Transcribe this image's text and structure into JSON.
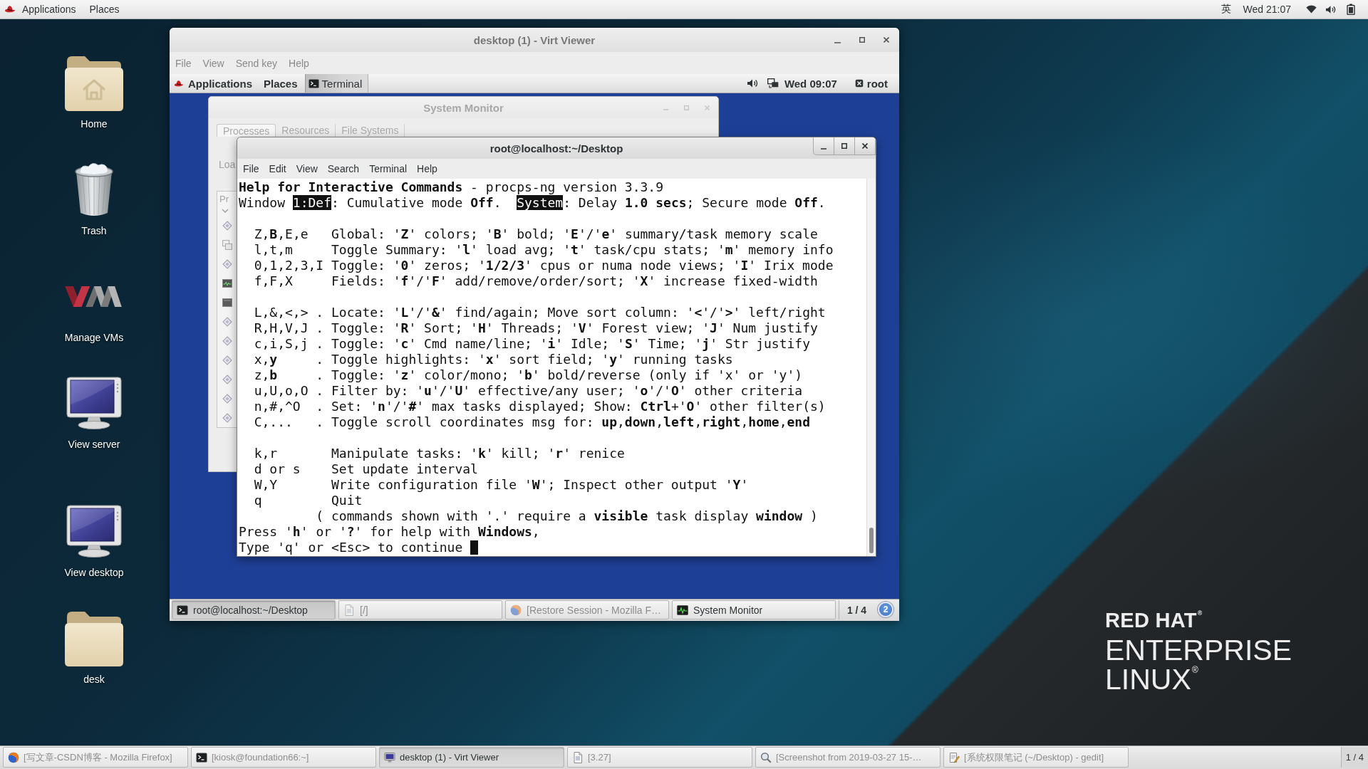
{
  "top_bar": {
    "applications": "Applications",
    "places": "Places",
    "input_method": "英",
    "clock": "Wed 21:07"
  },
  "desktop_icons": [
    {
      "kind": "home-folder",
      "label": "Home"
    },
    {
      "kind": "trash",
      "label": "Trash"
    },
    {
      "kind": "logo",
      "label": "Manage VMs"
    },
    {
      "kind": "monitor",
      "label": "View server"
    },
    {
      "kind": "monitor",
      "label": "View desktop"
    },
    {
      "kind": "folder",
      "label": "desk"
    }
  ],
  "viewer": {
    "title": "desktop (1) - Virt Viewer",
    "menu": [
      "File",
      "View",
      "Send key",
      "Help"
    ],
    "guest_top_bar": {
      "applications": "Applications",
      "places": "Places",
      "window_button": "Terminal",
      "clock": "Wed 09:07",
      "user": "root"
    },
    "system_monitor": {
      "title": "System Monitor",
      "tabs": [
        {
          "label": "Processes",
          "selected": true
        },
        {
          "label": "Resources",
          "selected": false
        },
        {
          "label": "File Systems",
          "selected": false
        }
      ],
      "load_label": "Loa",
      "column_header": "Pr"
    },
    "terminal": {
      "title": "root@localhost:~/Desktop",
      "menu": [
        "File",
        "Edit",
        "View",
        "Search",
        "Terminal",
        "Help"
      ],
      "lines": [
        {
          "kind": "heading",
          "text": "**Help for Interactive Commands** - procps-ng version 3.3.9"
        },
        {
          "kind": "status",
          "segments": [
            {
              "kind": "plain",
              "text": "Window "
            },
            {
              "kind": "reverse",
              "text": "1:Def"
            },
            {
              "kind": "plain",
              "text": ": Cumulative mode "
            },
            {
              "kind": "bold",
              "text": "Off"
            },
            {
              "kind": "plain",
              "text": ".  "
            },
            {
              "kind": "reverse",
              "text": "System"
            },
            {
              "kind": "plain",
              "text": ": Delay "
            },
            {
              "kind": "bold",
              "text": "1.0 secs"
            },
            {
              "kind": "plain",
              "text": "; Secure mode "
            },
            {
              "kind": "bold",
              "text": "Off"
            },
            {
              "kind": "plain",
              "text": "."
            }
          ]
        },
        {
          "kind": "blank"
        },
        {
          "kind": "command",
          "keys": "Z,**B**,E,e",
          "text": "Global: '**Z**' colors; '**B**' bold; '**E**'/'**e**' summary/task memory scale"
        },
        {
          "kind": "command",
          "keys": "l,t,m",
          "text": "Toggle Summary: '**l**' load avg; '**t**' task/cpu stats; '**m**' memory info"
        },
        {
          "kind": "command",
          "keys": "0,1,2,3,I",
          "text": "Toggle: '**0**' zeros; '**1/2/3**' cpus or numa node views; '**I**' Irix mode"
        },
        {
          "kind": "command",
          "keys": "f,F,X",
          "text": "Fields: '**f**'/'**F**' add/remove/order/sort; '**X**' increase fixed-width"
        },
        {
          "kind": "blank"
        },
        {
          "kind": "command",
          "keys": "L,&,<,>",
          "dot": ".",
          "text": "Locate: '**L**'/'**&**' find/again; Move sort column: '**<**'/'**>**' left/right"
        },
        {
          "kind": "command",
          "keys": "R,H,V,J",
          "dot": ".",
          "text": "Toggle: '**R**' Sort; '**H**' Threads; '**V**' Forest view; '**J**' Num justify"
        },
        {
          "kind": "command",
          "keys": "c,i,S,j",
          "dot": ".",
          "text": "Toggle: '**c**' Cmd name/line; '**i**' Idle; '**S**' Time; '**j**' Str justify"
        },
        {
          "kind": "command",
          "keys": "x,**y**",
          "dot": ".",
          "text": "Toggle highlights: '**x**' sort field; '**y**' running tasks"
        },
        {
          "kind": "command",
          "keys": "z,**b**",
          "dot": ".",
          "text": "Toggle: '**z**' color/mono; '**b**' bold/reverse (only if 'x' or 'y')"
        },
        {
          "kind": "command",
          "keys": "u,U,o,O",
          "dot": ".",
          "text": "Filter by: '**u**'/'**U**' effective/any user; '**o**'/'**O**' other criteria"
        },
        {
          "kind": "command",
          "keys": "n,#,^O",
          "dot": ".",
          "text": "Set: '**n**'/'**#**' max tasks displayed; Show: **Ctrl**+'**O**' other filter(s)"
        },
        {
          "kind": "command",
          "keys": "C,...",
          "dot": ".",
          "text": "Toggle scroll coordinates msg for: **up**,**down**,**left**,**right**,**home**,**end**"
        },
        {
          "kind": "blank"
        },
        {
          "kind": "command",
          "keys": "k,r",
          "text": "Manipulate tasks: '**k**' kill; '**r**' renice"
        },
        {
          "kind": "command",
          "keys": "d or s",
          "text": "Set update interval"
        },
        {
          "kind": "command",
          "keys": "W,Y",
          "text": "Write configuration file '**W**'; Inspect other output '**Y**'"
        },
        {
          "kind": "command",
          "keys": "q",
          "text": "Quit"
        },
        {
          "kind": "note",
          "text": "( commands shown with '.' require a **visible** task display **window** )"
        },
        {
          "kind": "prompt",
          "text": "Press '**h**' or '**?**' for help with **Windows**,"
        },
        {
          "kind": "prompt",
          "text": "Type 'q' or <Esc> to continue",
          "cursor": true
        }
      ]
    },
    "guest_taskbar": {
      "items": [
        {
          "kind": "terminal",
          "label": "root@localhost:~/Desktop",
          "selected": true,
          "minimized": false
        },
        {
          "kind": "file",
          "label": "[/]",
          "selected": false,
          "minimized": true
        },
        {
          "kind": "browser",
          "label": "[Restore Session - Mozilla F…",
          "selected": false,
          "minimized": true
        },
        {
          "kind": "system-monitor",
          "label": "System Monitor",
          "selected": false,
          "minimized": false
        }
      ],
      "workspace": "1 / 4",
      "notification_count": "2"
    }
  },
  "wallpaper_logo": [
    "RED HAT$^{®}$",
    "ENTERPRISE",
    "LINUX$^{®}$"
  ],
  "taskbar": {
    "items": [
      {
        "kind": "browser",
        "label": "[写文章-CSDN博客 - Mozilla Firefox]",
        "selected": false,
        "minimized": true
      },
      {
        "kind": "terminal",
        "label": "[kiosk@foundation66:~]",
        "selected": false,
        "minimized": true
      },
      {
        "kind": "viewer",
        "label": "desktop (1) - Virt Viewer",
        "selected": true,
        "minimized": false
      },
      {
        "kind": "file",
        "label": "[3.27]",
        "selected": false,
        "minimized": true
      },
      {
        "kind": "screenshot",
        "label": "[Screenshot from 2019-03-27 15-…",
        "selected": false,
        "minimized": true
      },
      {
        "kind": "editor",
        "label": "[系统权限笔记 (~/Desktop) - gedit]",
        "selected": false,
        "minimized": true
      }
    ],
    "workspace": "1 / 4"
  }
}
